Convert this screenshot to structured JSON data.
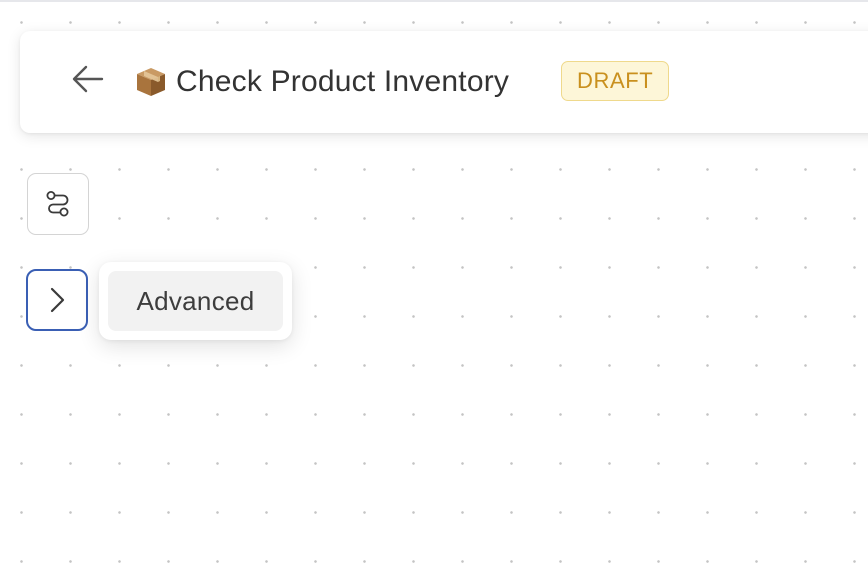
{
  "header": {
    "title_emoji": "📦",
    "title": "Check Product Inventory",
    "status_badge": "DRAFT"
  },
  "sidebar": {
    "workflow_button": {
      "icon": "workflow-path-icon"
    },
    "expand_button": {
      "icon": "chevron-right-icon",
      "tooltip": "Advanced"
    }
  },
  "colors": {
    "badge_bg": "#fdf6d8",
    "badge_border": "#efd98c",
    "badge_text": "#c9901e",
    "focus_ring": "#3a5fb4"
  }
}
